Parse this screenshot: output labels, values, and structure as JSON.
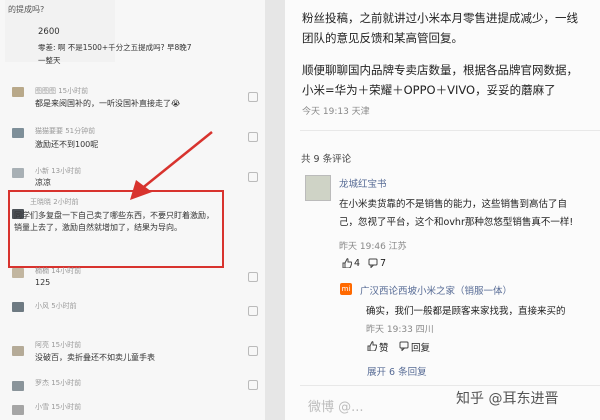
{
  "left_panel": {
    "top_question": "的提成吗?",
    "quote_number": "2600",
    "quote_line1": "零差: 啊 不是1500+千分之五提成吗? 早8晚7",
    "quote_line2": "一整天",
    "comments": [
      {
        "name": "图图图 15小时前",
        "text": "都是来阅国补的，一听没国补直接走了😭"
      },
      {
        "name": "猫猫要要 51分钟前",
        "text": "激励还不到100呢"
      },
      {
        "name": "小新 13小时前",
        "text": "凉凉"
      },
      {
        "name": "王晓晓 2小时前",
        "text": "同学们多复盘一下自己卖了哪些东西，不要只盯着激励，销量上去了，激励自然就增加了，结果为导向。"
      },
      {
        "name": "楠楠 14小时前",
        "text": "125"
      },
      {
        "name": "小风 5小时前",
        "text": ""
      },
      {
        "name": "阿亮 15小时前",
        "text": "没破百，卖折叠还不如卖儿童手表"
      },
      {
        "name": "罗杰 15小时前",
        "text": ""
      },
      {
        "name": "小雪 15小时前",
        "text": ""
      }
    ]
  },
  "right_panel": {
    "post_line1": "粉丝投稿，之前就讲过小米本月零售进提成减少，一线",
    "post_line2": "团队的意见反馈和某高管回复。",
    "post_line3": "顺便聊聊国内品牌专卖店数量，根据各品牌官网数据，",
    "post_line4": "小米=华为＋荣耀＋OPPO＋VIVO，妥妥的蘑麻了",
    "post_meta": "今天 19:13 天津",
    "comment_count": "共 9 条评论",
    "comment1": {
      "user": "龙城红宝书",
      "text_line1": "在小米卖货靠的不是销售的能力，这些销售到高估了自",
      "text_line2": "己，忽视了平台，这个和ovhr那种忽悠型销售真不一样!",
      "meta": "昨天 19:46 江苏",
      "likes": "4",
      "replies": "7"
    },
    "reply1": {
      "user": "广汉西论西坡小米之家（销服一体）",
      "text": "确实，我们一般都是顾客来家找我，直接来买的",
      "meta": "昨天 19:33 四川",
      "like_label": "赞",
      "reply_label": "回复"
    },
    "expand_label": "展开 6 条回复"
  },
  "watermarks": {
    "zhihu": "知乎 @耳东进晋",
    "weibo": "微博 @..."
  }
}
